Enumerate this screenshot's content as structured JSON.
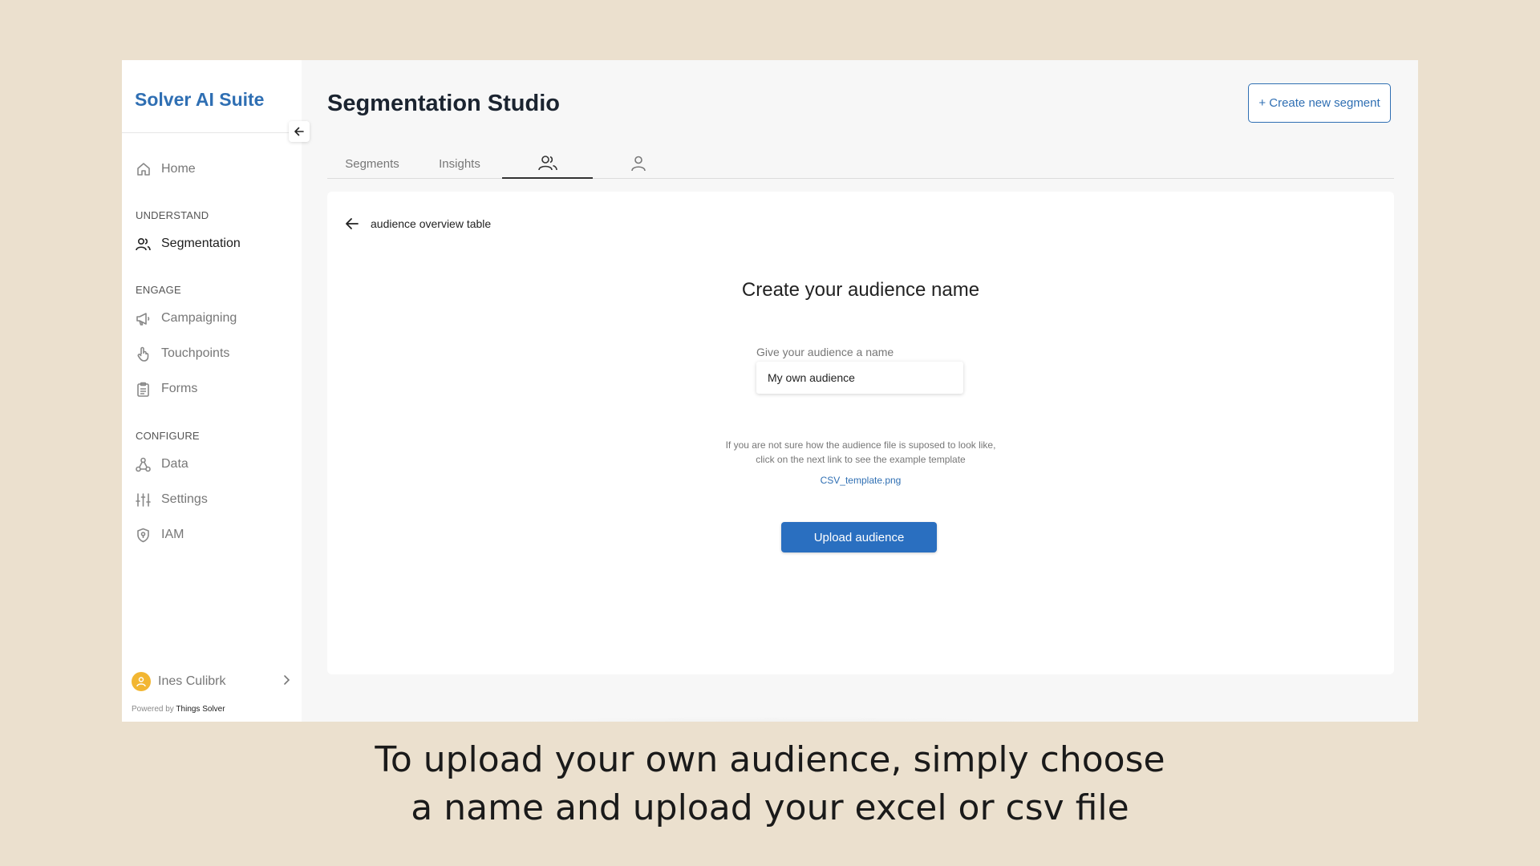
{
  "sidebar": {
    "brand": "Solver AI Suite",
    "home": "Home",
    "sections": {
      "understand": "UNDERSTAND",
      "engage": "ENGAGE",
      "configure": "CONFIGURE"
    },
    "items": {
      "segmentation": "Segmentation",
      "campaigning": "Campaigning",
      "touchpoints": "Touchpoints",
      "forms": "Forms",
      "data": "Data",
      "settings": "Settings",
      "iam": "IAM"
    },
    "user": {
      "name": "Ines Culibrk"
    },
    "powered_prefix": "Powered by",
    "powered_brand": "Things Solver"
  },
  "header": {
    "title": "Segmentation Studio",
    "create_button": "+ Create new segment"
  },
  "tabs": {
    "segments": "Segments",
    "insights": "Insights",
    "audiences_icon": "users-icon",
    "profile_icon": "user-icon"
  },
  "card": {
    "back_label": "audience overview table",
    "title": "Create your audience name",
    "field_label": "Give your audience a name",
    "input_value": "My own audience",
    "help_line1": "If you are not sure how the audience file is suposed to look like,",
    "help_line2": "click on the next link to see the example template",
    "template_link": "CSV_template.png",
    "upload_button": "Upload audience"
  },
  "caption": {
    "line1": "To upload your own audience, simply choose",
    "line2": "a name and upload your excel or csv file"
  },
  "colors": {
    "accent": "#2f6fb3",
    "background": "#ebe0ce",
    "avatar": "#f2b632"
  }
}
